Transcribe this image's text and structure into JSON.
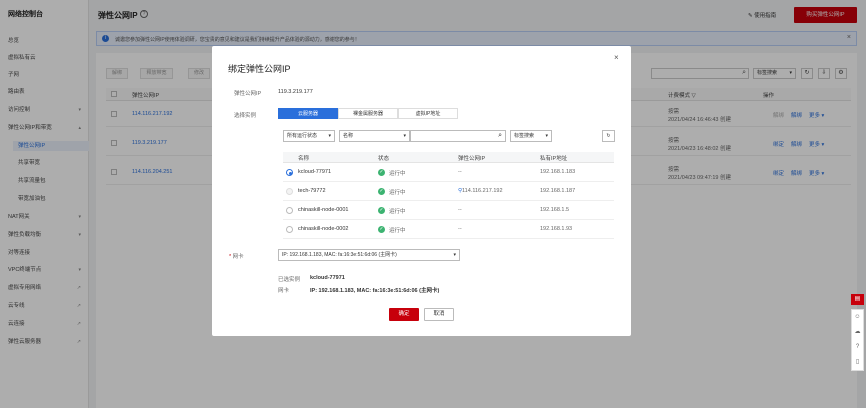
{
  "sidebar": {
    "title": "网络控制台",
    "items": [
      {
        "label": "总览"
      },
      {
        "label": "虚拟私有云"
      },
      {
        "label": "子网"
      },
      {
        "label": "路由表"
      },
      {
        "label": "访问控制"
      },
      {
        "label": "弹性公网IP和带宽"
      },
      {
        "label": "弹性公网IP"
      },
      {
        "label": "共享带宽"
      },
      {
        "label": "共享流量包"
      },
      {
        "label": "带宽加油包"
      },
      {
        "label": "NAT网关"
      },
      {
        "label": "弹性负载均衡"
      },
      {
        "label": "对等连接"
      },
      {
        "label": "VPC终端节点"
      },
      {
        "label": "虚拟专用网络"
      },
      {
        "label": "云专线"
      },
      {
        "label": "云连接"
      },
      {
        "label": "弹性云服务器"
      }
    ]
  },
  "header": {
    "title": "弹性公网IP",
    "guide": "使用指南",
    "buy_button": "购买弹性公网IP"
  },
  "notice": {
    "text": "诚邀您参加弹性公网IP使用体验调研，您宝贵的意见和建议是我们持续提升产品体验的源动力，感谢您的参与！"
  },
  "toolbar": {
    "buttons": [
      "解绑",
      "释放带宽",
      "修改"
    ],
    "tag_search": "标签搜索"
  },
  "table": {
    "headers": [
      "弹性公网IP",
      "计费模式",
      "操作"
    ],
    "rows": [
      {
        "ip": "114.116.217.192",
        "billing": "按需",
        "created": "2021/04/24 16:46:43 创建",
        "actions": [
          "解绑",
          "解绑",
          "更多"
        ]
      },
      {
        "ip": "119.3.219.177",
        "billing": "按需",
        "created": "2021/04/23 16:48:02 创建",
        "actions": [
          "绑定",
          "解绑",
          "更多"
        ]
      },
      {
        "ip": "114.116.204.251",
        "billing": "按需",
        "created": "2021/04/23 09:47:19 创建",
        "actions": [
          "绑定",
          "解绑",
          "更多"
        ]
      }
    ]
  },
  "modal": {
    "title": "绑定弹性公网IP",
    "eip_label": "弹性公网IP",
    "eip_value": "119.3.219.177",
    "instance_label": "选择实例",
    "tabs": [
      "云服务器",
      "裸金属服务器",
      "虚拟IP地址"
    ],
    "filter_status": "所有运行状态",
    "filter_field": "名称",
    "tag_search": "标签搜索",
    "columns": [
      "名称",
      "状态",
      "弹性公网IP",
      "私有IP地址"
    ],
    "rows": [
      {
        "name": "kcloud-77971",
        "status": "运行中",
        "eip": "--",
        "private_ip": "192.168.1.183",
        "selected": true
      },
      {
        "name": "tech-79772",
        "status": "运行中",
        "eip": "114.116.217.192",
        "private_ip": "192.168.1.187",
        "selected": false
      },
      {
        "name": "chinaskill-node-0001",
        "status": "运行中",
        "eip": "--",
        "private_ip": "192.168.1.5",
        "selected": false
      },
      {
        "name": "chinaskill-node-0002",
        "status": "运行中",
        "eip": "--",
        "private_ip": "192.168.1.93",
        "selected": false
      }
    ],
    "nic_label": "网卡",
    "nic_required": "*",
    "nic_value": "IP: 192.168.1.183, MAC: fa:16:3e:51:6d:06 (主网卡)",
    "selected_instance_label": "已选实例",
    "selected_instance_value": "kcloud-77971",
    "selected_nic_label": "网卡",
    "selected_nic_value": "IP: 192.168.1.183, MAC: fa:16:3e:51:6d:06 (主网卡)",
    "ok": "确定",
    "cancel": "取消"
  }
}
